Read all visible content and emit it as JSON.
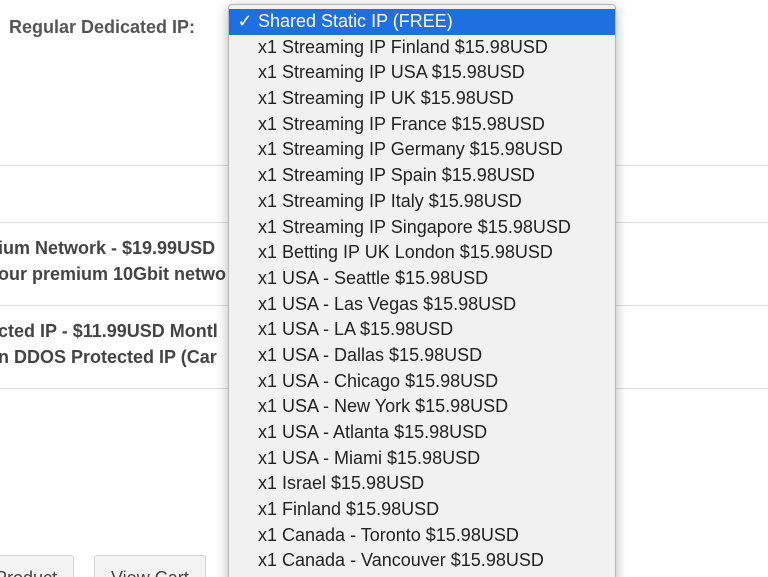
{
  "form": {
    "regular_ip_label": "Regular Dedicated IP:"
  },
  "addons": [
    {
      "title": "ium Network - $19.99USD",
      "description": "our premium 10Gbit netwo"
    },
    {
      "title": "cted IP - $11.99USD Montl",
      "description": "n DDOS Protected IP (Car"
    }
  ],
  "buttons": {
    "product_label": "Product",
    "view_cart_label": "View Cart"
  },
  "dropdown": {
    "selected_index": 0,
    "check_glyph": "✓",
    "options": [
      "Shared Static IP (FREE)",
      "x1 Streaming IP Finland $15.98USD",
      "x1 Streaming IP USA $15.98USD",
      "x1 Streaming IP UK $15.98USD",
      "x1 Streaming IP France $15.98USD",
      "x1 Streaming IP Germany $15.98USD",
      "x1 Streaming IP Spain $15.98USD",
      "x1 Streaming IP Italy $15.98USD",
      "x1 Streaming IP Singapore $15.98USD",
      "x1 Betting IP UK London $15.98USD",
      "x1 USA - Seattle $15.98USD",
      "x1 USA - Las Vegas $15.98USD",
      "x1 USA - LA $15.98USD",
      "x1 USA - Dallas $15.98USD",
      "x1 USA - Chicago $15.98USD",
      "x1 USA - New York $15.98USD",
      "x1 USA - Atlanta $15.98USD",
      "x1 USA - Miami $15.98USD",
      "x1 Israel $15.98USD",
      "x1 Finland $15.98USD",
      "x1 Canada - Toronto $15.98USD",
      "x1 Canada - Vancouver $15.98USD"
    ]
  },
  "colors": {
    "selected_background": "#1f6fe0",
    "menu_background": "#f1f1f1"
  }
}
